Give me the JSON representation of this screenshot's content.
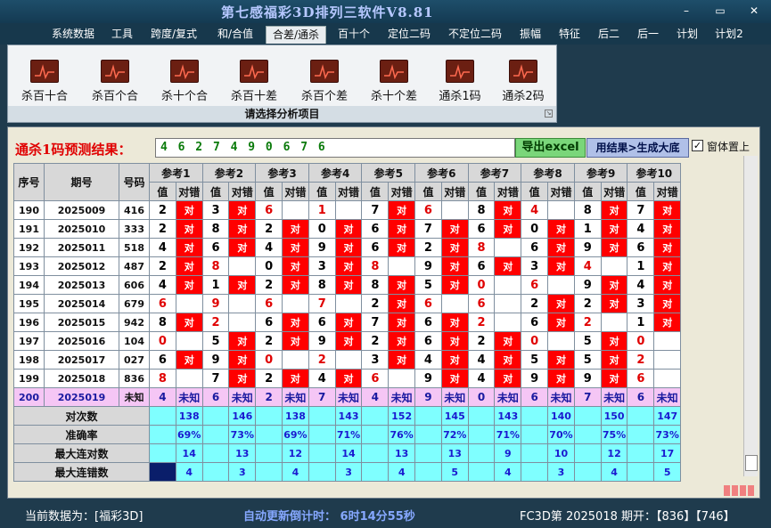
{
  "window": {
    "title": "第七感福彩3D排列三软件V8.81",
    "minimize": "–",
    "restore": "▭",
    "close": "✕"
  },
  "menu": [
    "系统数据",
    "工具",
    "跨度/复式",
    "和/合值",
    "合差/通杀",
    "百十个",
    "定位二码",
    "不定位二码",
    "振幅",
    "特征",
    "后二",
    "后一",
    "计划",
    "计划2"
  ],
  "ribbon": {
    "buttons": [
      "杀百十合",
      "杀百个合",
      "杀十个合",
      "杀百十差",
      "杀百个差",
      "杀十个差",
      "通杀1码",
      "通杀2码"
    ],
    "caption": "请选择分析项目"
  },
  "panel": {
    "result_label": "通杀1码预测结果：",
    "result_value": "4 6 2 7 4 9 0 6 7 6",
    "export_label": "导出excel",
    "generate_label": "用结果>生成大底",
    "pin_label": "窗体置上",
    "pin_checked": "✓"
  },
  "table": {
    "head": {
      "index": "序号",
      "period": "期号",
      "number": "号码"
    },
    "refs": [
      "参考1",
      "参考2",
      "参考3",
      "参考4",
      "参考5",
      "参考6",
      "参考7",
      "参考8",
      "参考9",
      "参考10"
    ],
    "sub_value": "值",
    "sub_hit": "对错",
    "hit_text": "对",
    "rows": [
      {
        "index": "190",
        "period": "2025009",
        "number": "416",
        "cells": [
          [
            "2",
            "1"
          ],
          [
            "3",
            "1"
          ],
          [
            "6",
            "0"
          ],
          [
            "1",
            "0"
          ],
          [
            "7",
            "1"
          ],
          [
            "6",
            "0"
          ],
          [
            "8",
            "1"
          ],
          [
            "4",
            "0"
          ],
          [
            "8",
            "1"
          ],
          [
            "7",
            "1"
          ]
        ]
      },
      {
        "index": "191",
        "period": "2025010",
        "number": "333",
        "cells": [
          [
            "2",
            "1"
          ],
          [
            "8",
            "1"
          ],
          [
            "2",
            "1"
          ],
          [
            "0",
            "1"
          ],
          [
            "6",
            "1"
          ],
          [
            "7",
            "1"
          ],
          [
            "6",
            "1"
          ],
          [
            "0",
            "1"
          ],
          [
            "1",
            "1"
          ],
          [
            "4",
            "1"
          ]
        ]
      },
      {
        "index": "192",
        "period": "2025011",
        "number": "518",
        "cells": [
          [
            "4",
            "1"
          ],
          [
            "6",
            "1"
          ],
          [
            "4",
            "1"
          ],
          [
            "9",
            "1"
          ],
          [
            "6",
            "1"
          ],
          [
            "2",
            "1"
          ],
          [
            "8",
            "0"
          ],
          [
            "6",
            "1"
          ],
          [
            "9",
            "1"
          ],
          [
            "6",
            "1"
          ]
        ]
      },
      {
        "index": "193",
        "period": "2025012",
        "number": "487",
        "cells": [
          [
            "2",
            "1"
          ],
          [
            "8",
            "0"
          ],
          [
            "0",
            "1"
          ],
          [
            "3",
            "1"
          ],
          [
            "8",
            "0"
          ],
          [
            "9",
            "1"
          ],
          [
            "6",
            "1"
          ],
          [
            "3",
            "1"
          ],
          [
            "4",
            "0"
          ],
          [
            "1",
            "1"
          ]
        ]
      },
      {
        "index": "194",
        "period": "2025013",
        "number": "606",
        "cells": [
          [
            "4",
            "1"
          ],
          [
            "1",
            "1"
          ],
          [
            "2",
            "1"
          ],
          [
            "8",
            "1"
          ],
          [
            "8",
            "1"
          ],
          [
            "5",
            "1"
          ],
          [
            "0",
            "0"
          ],
          [
            "6",
            "0"
          ],
          [
            "9",
            "1"
          ],
          [
            "4",
            "1"
          ]
        ]
      },
      {
        "index": "195",
        "period": "2025014",
        "number": "679",
        "cells": [
          [
            "6",
            "0"
          ],
          [
            "9",
            "0"
          ],
          [
            "6",
            "0"
          ],
          [
            "7",
            "0"
          ],
          [
            "2",
            "1"
          ],
          [
            "6",
            "0"
          ],
          [
            "6",
            "0"
          ],
          [
            "2",
            "1"
          ],
          [
            "2",
            "1"
          ],
          [
            "3",
            "1"
          ]
        ]
      },
      {
        "index": "196",
        "period": "2025015",
        "number": "942",
        "cells": [
          [
            "8",
            "1"
          ],
          [
            "2",
            "0"
          ],
          [
            "6",
            "1"
          ],
          [
            "6",
            "1"
          ],
          [
            "7",
            "1"
          ],
          [
            "6",
            "1"
          ],
          [
            "2",
            "0"
          ],
          [
            "6",
            "1"
          ],
          [
            "2",
            "0"
          ],
          [
            "1",
            "1"
          ]
        ]
      },
      {
        "index": "197",
        "period": "2025016",
        "number": "104",
        "cells": [
          [
            "0",
            "0"
          ],
          [
            "5",
            "1"
          ],
          [
            "2",
            "1"
          ],
          [
            "9",
            "1"
          ],
          [
            "2",
            "1"
          ],
          [
            "6",
            "1"
          ],
          [
            "2",
            "1"
          ],
          [
            "0",
            "0"
          ],
          [
            "5",
            "1"
          ],
          [
            "0",
            "0"
          ]
        ]
      },
      {
        "index": "198",
        "period": "2025017",
        "number": "027",
        "cells": [
          [
            "6",
            "1"
          ],
          [
            "9",
            "1"
          ],
          [
            "0",
            "0"
          ],
          [
            "2",
            "0"
          ],
          [
            "3",
            "1"
          ],
          [
            "4",
            "1"
          ],
          [
            "4",
            "1"
          ],
          [
            "5",
            "1"
          ],
          [
            "5",
            "1"
          ],
          [
            "2",
            "0"
          ]
        ]
      },
      {
        "index": "199",
        "period": "2025018",
        "number": "836",
        "cells": [
          [
            "8",
            "0"
          ],
          [
            "7",
            "1"
          ],
          [
            "2",
            "1"
          ],
          [
            "4",
            "1"
          ],
          [
            "6",
            "0"
          ],
          [
            "9",
            "1"
          ],
          [
            "4",
            "1"
          ],
          [
            "9",
            "1"
          ],
          [
            "9",
            "1"
          ],
          [
            "6",
            "0"
          ]
        ]
      }
    ],
    "pending": {
      "index": "200",
      "period": "2025019",
      "number": "未知",
      "unknown": "未知",
      "values": [
        "4",
        "6",
        "2",
        "7",
        "4",
        "9",
        "0",
        "6",
        "7",
        "6"
      ]
    },
    "stats": [
      {
        "label": "对次数",
        "values": [
          "138",
          "146",
          "138",
          "143",
          "152",
          "145",
          "143",
          "140",
          "150",
          "147"
        ]
      },
      {
        "label": "准确率",
        "values": [
          "69%",
          "73%",
          "69%",
          "71%",
          "76%",
          "72%",
          "71%",
          "70%",
          "75%",
          "73%"
        ]
      },
      {
        "label": "最大连对数",
        "values": [
          "14",
          "13",
          "12",
          "14",
          "13",
          "13",
          "9",
          "10",
          "12",
          "17"
        ]
      },
      {
        "label": "最大连错数",
        "values": [
          "4",
          "3",
          "4",
          "3",
          "4",
          "5",
          "4",
          "3",
          "4",
          "5"
        ]
      }
    ]
  },
  "status": {
    "data_source": "当前数据为：[福彩3D]",
    "countdown": "自动更新倒计时： 6时14分55秒",
    "last_draw": "FC3D第 2025018 期开：【836】【746】"
  },
  "colors": {
    "hit": "#ff0000",
    "pending": "#f5c6f5",
    "stats": "#7fffff",
    "result_text": "#0a7a0a"
  }
}
